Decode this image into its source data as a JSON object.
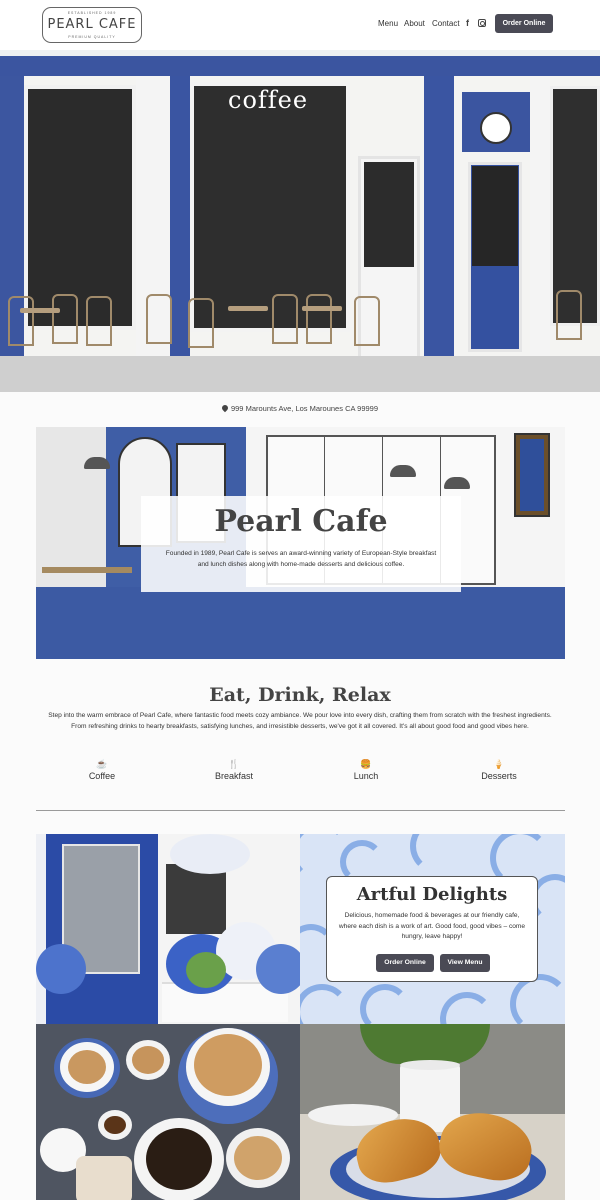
{
  "header": {
    "logo": {
      "top_text": "ESTABLISHED 1989",
      "name": "PEARL CAFE",
      "bottom_text": "PREMIUM QUALITY"
    },
    "nav": {
      "menu": "Menu",
      "about": "About",
      "contact": "Contact"
    },
    "social": {
      "facebook_icon": "f"
    },
    "order_button": "Order Online"
  },
  "storefront": {
    "sign_text": "coffee"
  },
  "address": "999 Marounts Ave, Los Marounes CA 99999",
  "hero": {
    "title": "Pearl Cafe",
    "description": "Founded in 1989, Pearl Cafe is serves an award-winning variety of European-Style breakfast and lunch dishes along with home-made desserts and delicious coffee."
  },
  "eat_drink_relax": {
    "title": "Eat, Drink, Relax",
    "text": "Step into the warm embrace of Pearl Cafe, where fantastic food meets cozy ambiance. We pour love into every dish, crafting them from scratch with the freshest ingredients. From refreshing drinks to hearty breakfasts, satisfying lunches, and irresistible desserts, we've got it all covered. It's all about good food and good vibes here."
  },
  "categories": [
    {
      "label": "Coffee",
      "icon": "coffee-cup-icon"
    },
    {
      "label": "Breakfast",
      "icon": "utensils-icon"
    },
    {
      "label": "Lunch",
      "icon": "burger-icon"
    },
    {
      "label": "Desserts",
      "icon": "ice-cream-icon"
    }
  ],
  "artful": {
    "title": "Artful Delights",
    "text": "Delicious, homemade food & beverages at our friendly cafe, where each dish is a work of art. Good food, good vibes – come hungry, leave happy!",
    "order_button": "Order Online",
    "menu_button": "View Menu"
  },
  "colors": {
    "accent_blue": "#3a55a2",
    "button_dark": "#4a4a55"
  }
}
